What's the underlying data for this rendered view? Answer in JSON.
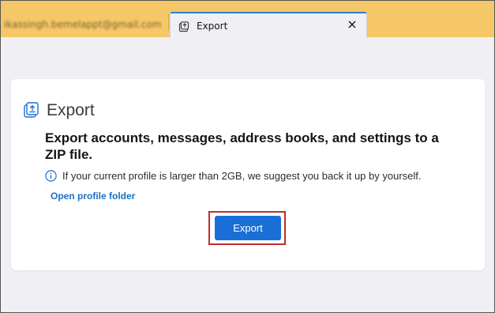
{
  "tabs": {
    "inactive": {
      "label": "ikassingh.bemelappt@gmail.com"
    },
    "active": {
      "label": "Export",
      "icon": "export-tab-icon",
      "close_icon": "close-icon"
    }
  },
  "export_panel": {
    "title": "Export",
    "title_icon": "export-icon",
    "description": "Export accounts, messages, address books, and settings to a ZIP file.",
    "note_icon": "info-icon",
    "note": "If your current profile is larger than 2GB, we suggest you back it up by yourself.",
    "open_folder_link": "Open profile folder",
    "export_button": "Export"
  },
  "colors": {
    "tabbar": "#f6c766",
    "accent": "#1a6fd6",
    "link": "#1c6fc4",
    "highlight": "#c42b2b"
  }
}
